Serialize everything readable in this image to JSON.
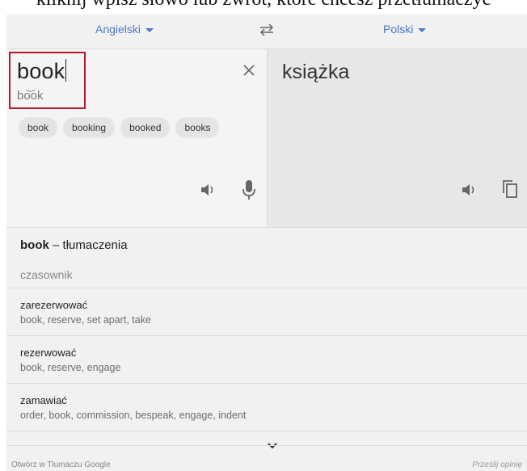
{
  "caption": "kliknij wpisz słowo lub zwrot, które chcesz przetłumaczyć",
  "languages": {
    "source": "Angielski",
    "target": "Polski"
  },
  "input": {
    "text": "book",
    "phonetic": "bo͝ok",
    "suggestions": [
      "book",
      "booking",
      "booked",
      "books"
    ]
  },
  "output": {
    "text": "książka"
  },
  "dictionary": {
    "word": "book",
    "suffix": "– tłumaczenia",
    "part_of_speech": "czasownik",
    "entries": [
      {
        "word": "zarezerwować",
        "synonyms": "book, reserve, set apart, take"
      },
      {
        "word": "rezerwować",
        "synonyms": "book, reserve, engage"
      },
      {
        "word": "zamawiać",
        "synonyms": "order, book, commission, bespeak, engage, indent"
      }
    ]
  },
  "footer": {
    "left": "Otwórz w Tłumaczu Google",
    "right": "Prześlij opinię"
  },
  "colors": {
    "accent": "#4a78c7",
    "highlight_border": "#b31b2a"
  }
}
